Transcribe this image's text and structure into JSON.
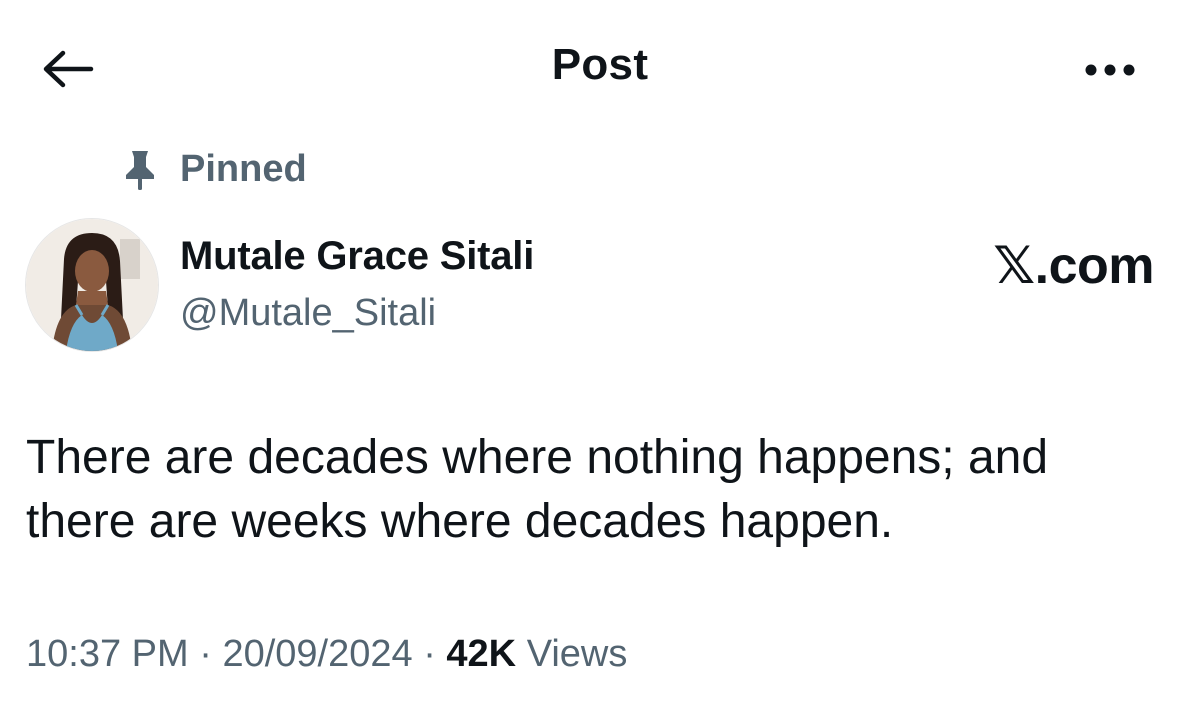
{
  "header": {
    "title": "Post",
    "back_icon": "arrow-left-icon",
    "more_icon": "more-horizontal-icon"
  },
  "pinned": {
    "icon": "pin-icon",
    "label": "Pinned"
  },
  "author": {
    "display_name": "Mutale Grace Sitali",
    "handle": "@Mutale_Sitali"
  },
  "brand": {
    "text": "𝕏.com"
  },
  "post": {
    "text": "There are decades where nothing happens; and there are weeks where decades happen."
  },
  "meta": {
    "time": "10:37 PM",
    "separator": "·",
    "date": "20/09/2024",
    "views_count": "42K",
    "views_label": "Views"
  },
  "colors": {
    "primary_text": "#0f1419",
    "secondary_text": "#536471",
    "background": "#ffffff"
  }
}
